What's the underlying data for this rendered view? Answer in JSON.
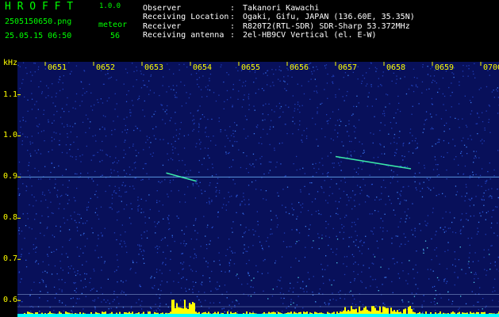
{
  "app": {
    "title": "H R O F F T",
    "version": "1.0.0",
    "filename": "2505150650.png",
    "datetime": "25.05.15 06:50",
    "meteor_label": "meteor",
    "meteor_count": "56"
  },
  "info": {
    "rows": [
      {
        "key": "Observer",
        "sep": ":",
        "value": "Takanori Kawachi"
      },
      {
        "key": "Receiving Location",
        "sep": ":",
        "value": "Ogaki, Gifu, JAPAN (136.60E, 35.35N)"
      },
      {
        "key": "Receiver",
        "sep": ":",
        "value": "R820T2(RTL-SDR) SDR-Sharp 53.372MHz"
      },
      {
        "key": "Receiving antenna",
        "sep": ":",
        "value": "2el-HB9CV Vertical (el. E-W)"
      }
    ]
  },
  "colors": {
    "background": "#000000",
    "spectrogram_base": "#08105a",
    "noise_dot": "#2a56d8",
    "echo": "#40ffb0",
    "tick_text": "#ffff00",
    "header_text": "#00ff00",
    "info_text": "#ffffff",
    "signal_bar": "#ffff00",
    "floor": "#00ffff"
  },
  "chart_data": {
    "type": "heatmap",
    "ylabel": "kHz",
    "x_ticks": [
      "0651",
      "0652",
      "0653",
      "0654",
      "0655",
      "0656",
      "0657",
      "0658",
      "0659",
      "0700"
    ],
    "y_ticks": [
      "1.1",
      "1.0",
      "0.9",
      "0.8",
      "0.7",
      "0.6"
    ],
    "ylim": [
      0.56,
      1.18
    ],
    "carrier_khz": 0.9,
    "meteor_echoes": [
      {
        "time": "06:53.5",
        "khz_start": 0.91,
        "khz_end": 0.89
      },
      {
        "time": "06:57.0",
        "khz_start": 0.95,
        "khz_end": 0.92
      }
    ]
  }
}
